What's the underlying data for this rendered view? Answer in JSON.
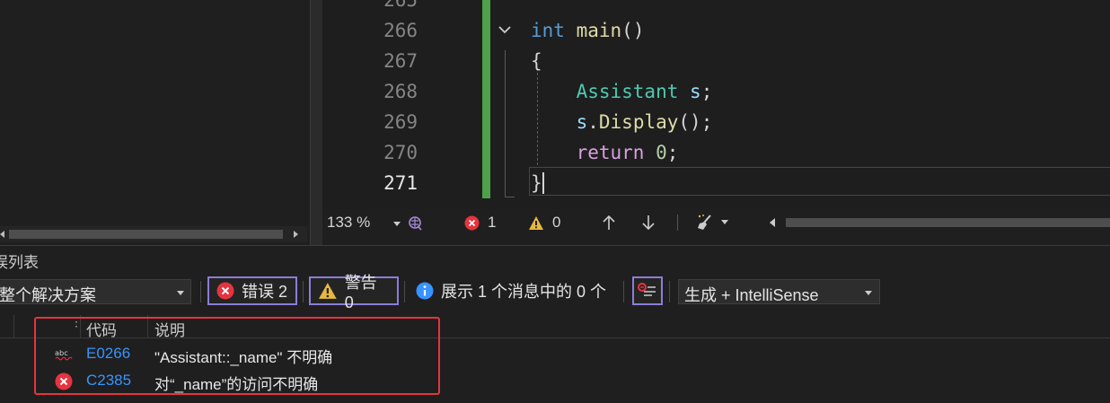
{
  "editor": {
    "partial_line_number": "265",
    "lines": [
      {
        "number": "266"
      },
      {
        "number": "267"
      },
      {
        "number": "268"
      },
      {
        "number": "269"
      },
      {
        "number": "270"
      },
      {
        "number": "271"
      }
    ],
    "code": {
      "l266_kw": "int",
      "l266_fn": "main",
      "l266_paren": "()",
      "l267": "{",
      "l268_type": "Assistant",
      "l268_var": "s",
      "l268_semi": ";",
      "l269_var": "s",
      "l269_dot": ".",
      "l269_fn": "Display",
      "l269_tail": "();",
      "l270_kw": "return",
      "l270_num": "0",
      "l270_semi": ";",
      "l271": "}"
    }
  },
  "editor_status": {
    "zoom": "133 %",
    "error_count": "1",
    "warning_count": "0"
  },
  "error_list": {
    "title": "误列表",
    "scope": "整个解决方案",
    "errors_label": "错误 2",
    "warnings_label": "警告 0",
    "messages_label": "展示 1 个消息中的 0 个",
    "build_filter": "生成 + IntelliSense",
    "columns": {
      "code": "代码",
      "description": "说明"
    },
    "rows": [
      {
        "icon": "spell-error-icon",
        "code": "E0266",
        "description": "\"Assistant::_name\" 不明确"
      },
      {
        "icon": "error-circle-icon",
        "code": "C2385",
        "description": "对“_name”的访问不明确"
      }
    ]
  },
  "colors": {
    "accent_border": "#8b7dd8",
    "error_red": "#e5343f",
    "change_bar": "#4ea04a",
    "link_blue": "#3794ff"
  }
}
